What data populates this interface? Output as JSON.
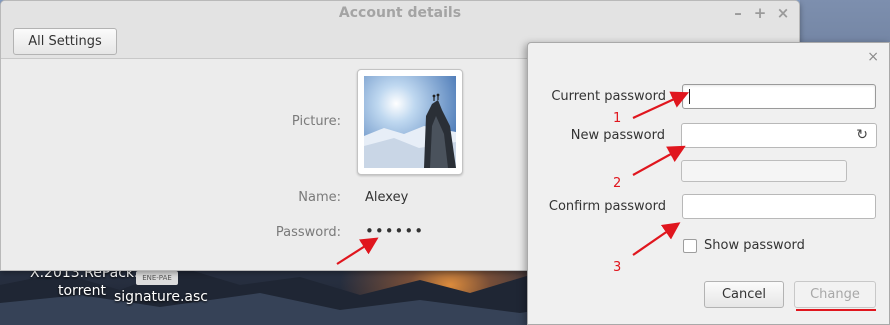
{
  "colors": {
    "annotation": "#e0161e",
    "window_bg": "#ececec",
    "dialog_bg": "#f0f0f0"
  },
  "main_window": {
    "title": "Account details",
    "controls": [
      "–",
      "+",
      "×"
    ],
    "all_settings_label": "All Settings",
    "picture_label": "Picture:",
    "name_label": "Name:",
    "name_value": "Alexey",
    "password_label": "Password:",
    "password_value": "••••••"
  },
  "desktop": {
    "items": [
      {
        "label": "X.2013.RePack."
      },
      {
        "label": "torrent"
      },
      {
        "label": "signature.asc"
      }
    ],
    "file_icon_text": "ENE-PAE"
  },
  "dialog": {
    "close_glyph": "×",
    "current_password_label": "Current password",
    "current_password_value": "",
    "new_password_label": "New password",
    "new_password_value": "",
    "generate_icon_glyph": "↻",
    "confirm_password_label": "Confirm password",
    "confirm_password_value": "",
    "show_password_label": "Show password",
    "show_password_checked": false,
    "cancel_label": "Cancel",
    "change_label": "Change"
  },
  "annotations": [
    "1",
    "2",
    "3"
  ]
}
